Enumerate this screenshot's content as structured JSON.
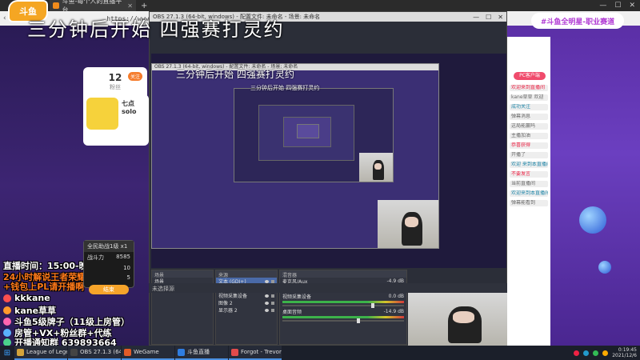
{
  "browser": {
    "tab_title": "斗鱼-每个人的直播平台",
    "url": "https://www.douyu.com/",
    "win_min": "—",
    "win_max": "☐",
    "win_close": "✕"
  },
  "logo_text": "斗鱼",
  "headline": "三分钟后开始 四强赛打灵约",
  "left": {
    "fans_count": "12",
    "fans_label": "粉丝",
    "fans_badge": "关注",
    "anchor_name": "七点solo",
    "lines": [
      {
        "text": "直播时间：15:00-晚上",
        "cls": ""
      },
      {
        "text": "24小时解说王者荣耀",
        "cls": "orange"
      },
      {
        "text": "+钱包上PL请开播啊",
        "cls": "orange"
      },
      {
        "text": "kkkane",
        "icon": "red"
      },
      {
        "text": "kane草草",
        "icon": "orange"
      },
      {
        "text": "斗鱼5级牌子（11级上房管）",
        "icon": "pink"
      },
      {
        "text": "房管+VX+粉丝群+代练",
        "icon": "blue"
      },
      {
        "text": "开播通知群 639893664",
        "icon": "green"
      }
    ],
    "mini_head": "全民助战1级 x1",
    "mini_rows": [
      [
        "战斗力",
        "8585"
      ],
      [
        "",
        "10"
      ],
      [
        "",
        "5"
      ]
    ],
    "mini_btn": "结束"
  },
  "right": {
    "banner": "#斗鱼全明星-职业赛道",
    "pc_btn": "PC客户端",
    "chat": [
      {
        "text": "欢迎来到直播间",
        "cls": "red"
      },
      {
        "text": "kane草草 欢迎",
        "cls": ""
      },
      {
        "text": "成功关注",
        "cls": "blue"
      },
      {
        "text": "弹幕消息",
        "cls": ""
      },
      {
        "text": "这局能赢吗",
        "cls": ""
      },
      {
        "text": "主播加油",
        "cls": ""
      },
      {
        "text": "恭喜获得",
        "cls": "red"
      },
      {
        "text": "开播了",
        "cls": ""
      },
      {
        "text": "欢迎 来到本直播间",
        "cls": "blue"
      },
      {
        "text": "不要发言",
        "cls": "red"
      },
      {
        "text": "当前直播间",
        "cls": ""
      },
      {
        "text": "欢迎来到本直播间",
        "cls": "blue"
      },
      {
        "text": "弹幕能看到",
        "cls": ""
      }
    ]
  },
  "obs": {
    "title": "OBS 27.1.3 (64-bit, windows) - 配置文件: 未命名 - 场景: 未命名",
    "scenes_label": "场景",
    "sources_label": "来源",
    "mixer_label": "混音器",
    "status": "未选择源",
    "scenes": [
      "场景"
    ],
    "sources": [
      {
        "name": "文本 (GDI+)",
        "sel": true
      },
      {
        "name": "图像 3",
        "sel": false
      },
      {
        "name": "视频采集设备",
        "sel": false
      },
      {
        "name": "图像 2",
        "sel": false
      },
      {
        "name": "显示器 2",
        "sel": false
      }
    ],
    "mixer": [
      {
        "name": "麦克风/Aux",
        "db": "-4.9 dB"
      },
      {
        "name": "视频采集设备",
        "db": "0.0 dB"
      },
      {
        "name": "桌面音频",
        "db": "-14.9 dB"
      }
    ]
  },
  "taskbar": {
    "items": [
      "League of Legends",
      "OBS 27.1.3 (64-bit...)",
      "WeGame",
      "斗鱼直播",
      "Forgot - Trevor D..."
    ],
    "time": "0:19:45",
    "date": "2021/12/6"
  }
}
